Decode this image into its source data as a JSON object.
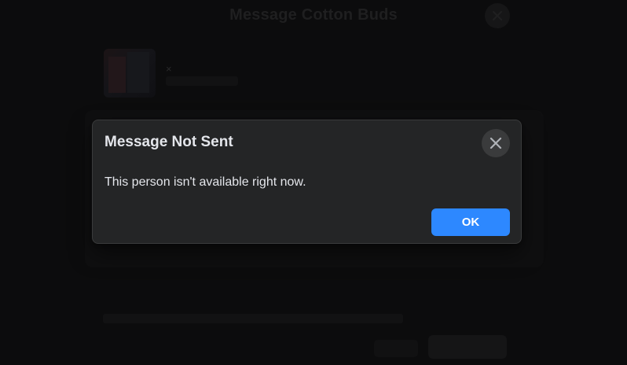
{
  "background": {
    "title": "Message Cotton Buds",
    "item_close_glyph": "×"
  },
  "dialog": {
    "title": "Message Not Sent",
    "message": "This person isn't available right now.",
    "ok_label": "OK",
    "close_icon": "close-icon",
    "colors": {
      "surface": "#242526",
      "primary": "#2d88ff",
      "text": "#e4e6eb",
      "close_bg": "#3a3b3c"
    }
  }
}
